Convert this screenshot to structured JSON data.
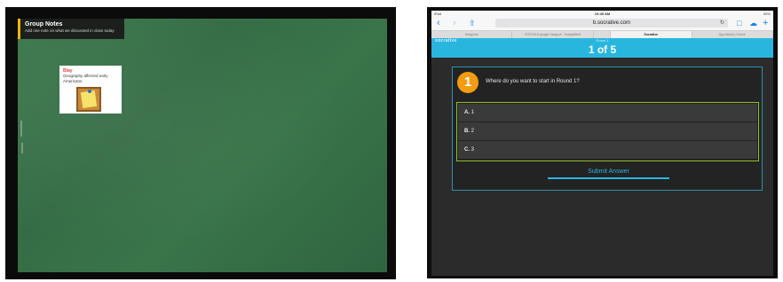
{
  "left_panel": {
    "header": {
      "title": "Group Notes",
      "subtitle": "Add one note on what we discussed in class today"
    },
    "note": {
      "author": "Blay",
      "text": "Geography affected early Americans",
      "image_icon": "sticky-note-on-corkboard"
    },
    "colors": {
      "board": "#3a7449",
      "header_accent": "#f2b705",
      "author": "#e0483c"
    }
  },
  "right_panel": {
    "status_bar": {
      "device": "iPad",
      "time": "10:45 AM",
      "battery": "92%"
    },
    "browser": {
      "url": "b.socrative.com",
      "tabs": [
        {
          "label": "Hangouts",
          "active": false
        },
        {
          "label": "ISTE2016 google Hangout - TodaysMeet",
          "active": false
        },
        {
          "label": "",
          "active": false
        },
        {
          "label": "Socrative",
          "active": true
        },
        {
          "label": "App Attack | Smore",
          "active": false
        }
      ]
    },
    "socrative": {
      "brand": "socrative",
      "room": "Room 1",
      "progress": "1 of 5",
      "question_number": "1",
      "question": "Where do you want to start in Round 1?",
      "answers": [
        {
          "letter": "A.",
          "text": "1"
        },
        {
          "letter": "B.",
          "text": "2"
        },
        {
          "letter": "C.",
          "text": "3"
        }
      ],
      "submit_label": "Submit Answer"
    },
    "colors": {
      "header": "#29b6de",
      "badge": "#f39c12",
      "answers_border": "#8fbf2a"
    }
  }
}
